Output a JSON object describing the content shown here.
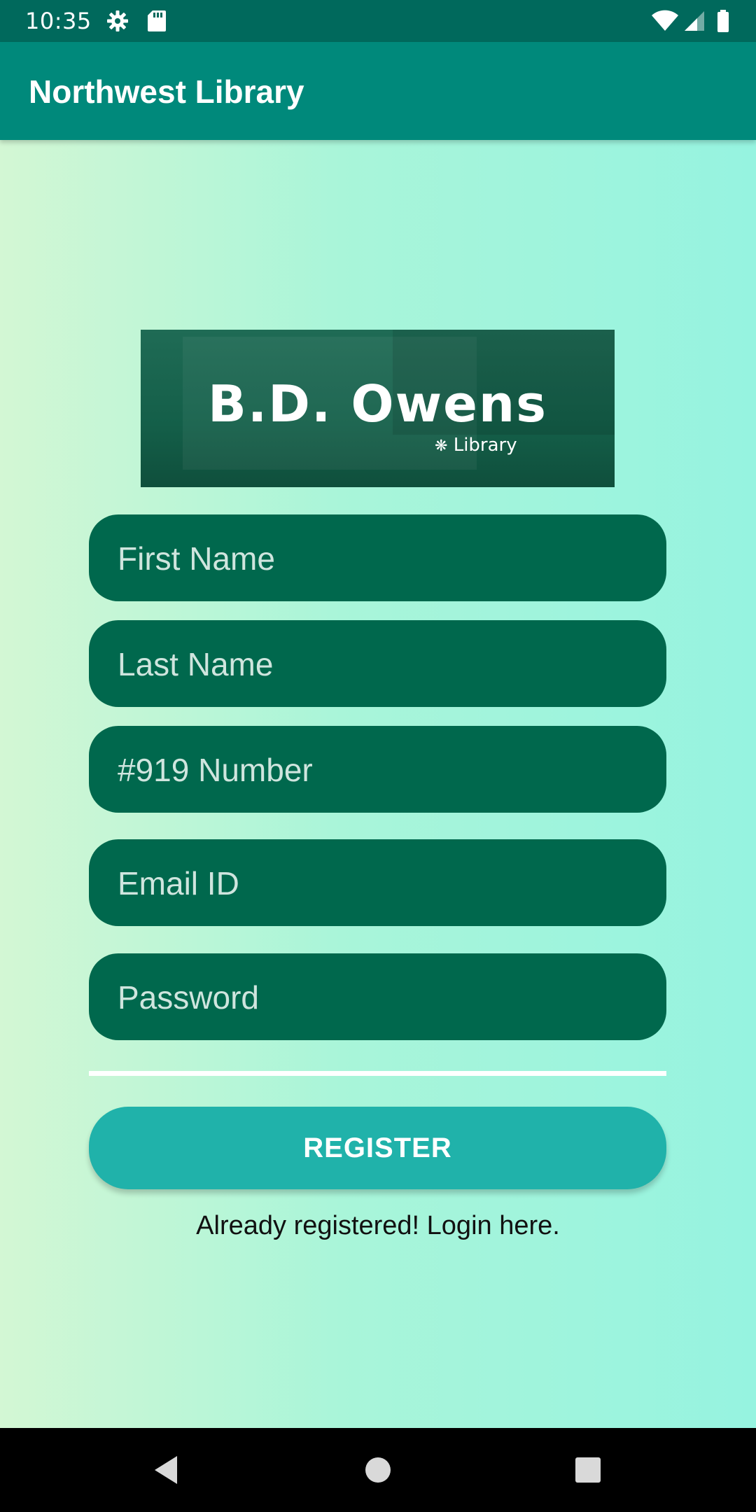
{
  "status_bar": {
    "time": "10:35",
    "left_icons": [
      "gear-icon",
      "sd-card-icon"
    ],
    "right_icons": [
      "wifi-icon",
      "signal-icon",
      "battery-icon"
    ]
  },
  "app_bar": {
    "title": "Northwest Library"
  },
  "banner": {
    "title": "B.D. Owens",
    "subtitle": "Library"
  },
  "form": {
    "fields": [
      {
        "placeholder": "First Name",
        "value": ""
      },
      {
        "placeholder": "Last Name",
        "value": ""
      },
      {
        "placeholder": "#919 Number",
        "value": ""
      },
      {
        "placeholder": "Email ID",
        "value": ""
      },
      {
        "placeholder": "Password",
        "value": ""
      }
    ],
    "register_label": "REGISTER",
    "login_link": "Already registered! Login here."
  },
  "colors": {
    "status_bar": "#00695c",
    "app_bar": "#00897b",
    "field": "#00684d",
    "button": "#20b2aa"
  },
  "nav_bar": {
    "buttons": [
      "back-icon",
      "home-icon",
      "recents-icon"
    ]
  }
}
